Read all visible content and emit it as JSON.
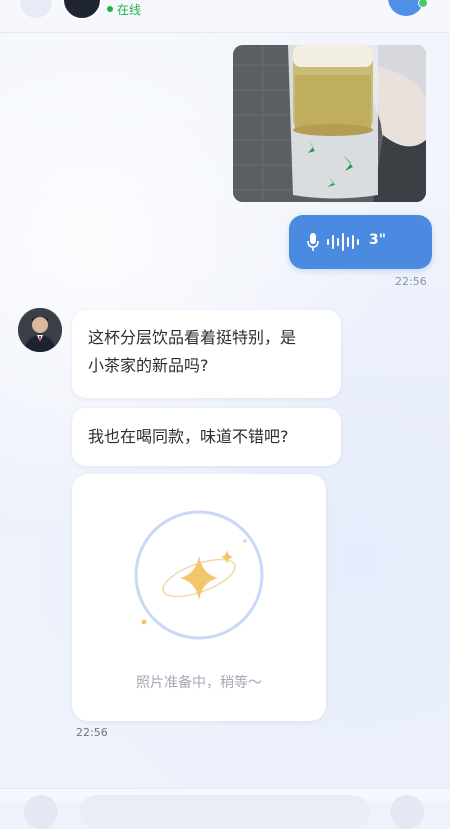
{
  "header": {
    "status_text": "在线",
    "status_color": "#27b04b"
  },
  "messages": {
    "voice": {
      "duration": "3\"",
      "time": "22:56"
    },
    "incoming": {
      "text1_line1": "这杯分层饮品看着挺特别，是",
      "text1_line2": "小茶家的新品吗?",
      "text2": "我也在喝同款，味道不错吧?",
      "photo_status": "照片准备中，稍等～",
      "time": "22:56"
    }
  },
  "colors": {
    "accent": "#4a8ae0",
    "bubble_bg": "#ffffff",
    "background": "#eef2fb"
  },
  "icons": {
    "voice": "microphone-icon",
    "wave": "sound-wave-icon",
    "loading": "sparkle-star-icon"
  }
}
